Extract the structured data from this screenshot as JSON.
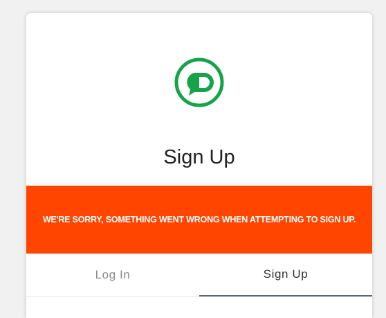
{
  "colors": {
    "brand_green": "#16a34a",
    "error_background": "#ff4500",
    "active_tab_underline": "#5c666f"
  },
  "logo": {
    "icon": "chat-bubble-icon"
  },
  "title": "Sign Up",
  "error": {
    "message": "WE'RE SORRY, SOMETHING WENT WRONG WHEN ATTEMPTING TO SIGN UP."
  },
  "tabs": [
    {
      "label": "Log In",
      "active": false
    },
    {
      "label": "Sign Up",
      "active": true
    }
  ]
}
